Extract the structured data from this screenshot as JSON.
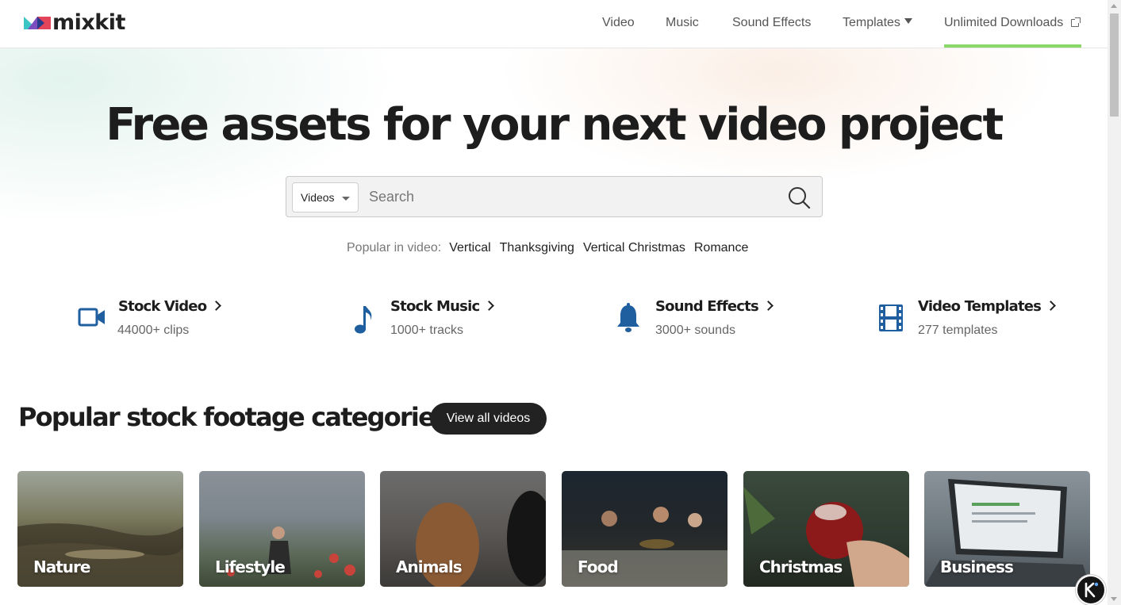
{
  "brand": {
    "name": "mixkit"
  },
  "nav": {
    "video": "Video",
    "music": "Music",
    "sound_effects": "Sound Effects",
    "templates": "Templates",
    "unlimited": "Unlimited Downloads"
  },
  "hero": {
    "title": "Free assets for your next video project",
    "search": {
      "category": "Videos",
      "placeholder": "Search"
    },
    "popular_label": "Popular in video:",
    "popular_tags": [
      "Vertical",
      "Thanksgiving",
      "Vertical Christmas",
      "Romance"
    ]
  },
  "assets": [
    {
      "title": "Stock Video",
      "subtitle": "44000+ clips",
      "icon": "video-camera-icon"
    },
    {
      "title": "Stock Music",
      "subtitle": "1000+ tracks",
      "icon": "music-note-icon"
    },
    {
      "title": "Sound Effects",
      "subtitle": "3000+ sounds",
      "icon": "bell-icon"
    },
    {
      "title": "Video Templates",
      "subtitle": "277 templates",
      "icon": "film-strip-icon"
    }
  ],
  "categories": {
    "heading": "Popular stock footage categories",
    "view_all": "View all videos",
    "items": [
      {
        "label": "Nature"
      },
      {
        "label": "Lifestyle"
      },
      {
        "label": "Animals"
      },
      {
        "label": "Food"
      },
      {
        "label": "Christmas"
      },
      {
        "label": "Business"
      }
    ]
  },
  "colors": {
    "accent_green": "#8bd86a",
    "icon_blue": "#1f5fa0",
    "dark": "#222222"
  }
}
